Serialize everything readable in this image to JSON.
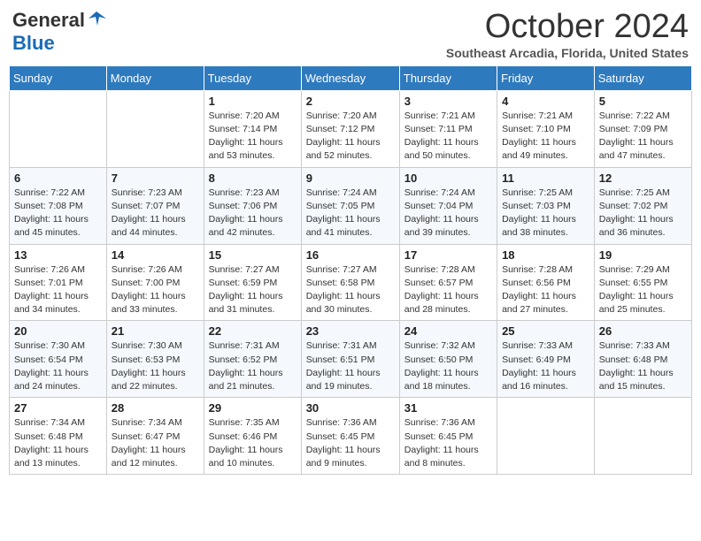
{
  "header": {
    "logo_general": "General",
    "logo_blue": "Blue",
    "month_title": "October 2024",
    "location": "Southeast Arcadia, Florida, United States"
  },
  "days_of_week": [
    "Sunday",
    "Monday",
    "Tuesday",
    "Wednesday",
    "Thursday",
    "Friday",
    "Saturday"
  ],
  "weeks": [
    [
      {
        "day": "",
        "info": ""
      },
      {
        "day": "",
        "info": ""
      },
      {
        "day": "1",
        "info": "Sunrise: 7:20 AM\nSunset: 7:14 PM\nDaylight: 11 hours and 53 minutes."
      },
      {
        "day": "2",
        "info": "Sunrise: 7:20 AM\nSunset: 7:12 PM\nDaylight: 11 hours and 52 minutes."
      },
      {
        "day": "3",
        "info": "Sunrise: 7:21 AM\nSunset: 7:11 PM\nDaylight: 11 hours and 50 minutes."
      },
      {
        "day": "4",
        "info": "Sunrise: 7:21 AM\nSunset: 7:10 PM\nDaylight: 11 hours and 49 minutes."
      },
      {
        "day": "5",
        "info": "Sunrise: 7:22 AM\nSunset: 7:09 PM\nDaylight: 11 hours and 47 minutes."
      }
    ],
    [
      {
        "day": "6",
        "info": "Sunrise: 7:22 AM\nSunset: 7:08 PM\nDaylight: 11 hours and 45 minutes."
      },
      {
        "day": "7",
        "info": "Sunrise: 7:23 AM\nSunset: 7:07 PM\nDaylight: 11 hours and 44 minutes."
      },
      {
        "day": "8",
        "info": "Sunrise: 7:23 AM\nSunset: 7:06 PM\nDaylight: 11 hours and 42 minutes."
      },
      {
        "day": "9",
        "info": "Sunrise: 7:24 AM\nSunset: 7:05 PM\nDaylight: 11 hours and 41 minutes."
      },
      {
        "day": "10",
        "info": "Sunrise: 7:24 AM\nSunset: 7:04 PM\nDaylight: 11 hours and 39 minutes."
      },
      {
        "day": "11",
        "info": "Sunrise: 7:25 AM\nSunset: 7:03 PM\nDaylight: 11 hours and 38 minutes."
      },
      {
        "day": "12",
        "info": "Sunrise: 7:25 AM\nSunset: 7:02 PM\nDaylight: 11 hours and 36 minutes."
      }
    ],
    [
      {
        "day": "13",
        "info": "Sunrise: 7:26 AM\nSunset: 7:01 PM\nDaylight: 11 hours and 34 minutes."
      },
      {
        "day": "14",
        "info": "Sunrise: 7:26 AM\nSunset: 7:00 PM\nDaylight: 11 hours and 33 minutes."
      },
      {
        "day": "15",
        "info": "Sunrise: 7:27 AM\nSunset: 6:59 PM\nDaylight: 11 hours and 31 minutes."
      },
      {
        "day": "16",
        "info": "Sunrise: 7:27 AM\nSunset: 6:58 PM\nDaylight: 11 hours and 30 minutes."
      },
      {
        "day": "17",
        "info": "Sunrise: 7:28 AM\nSunset: 6:57 PM\nDaylight: 11 hours and 28 minutes."
      },
      {
        "day": "18",
        "info": "Sunrise: 7:28 AM\nSunset: 6:56 PM\nDaylight: 11 hours and 27 minutes."
      },
      {
        "day": "19",
        "info": "Sunrise: 7:29 AM\nSunset: 6:55 PM\nDaylight: 11 hours and 25 minutes."
      }
    ],
    [
      {
        "day": "20",
        "info": "Sunrise: 7:30 AM\nSunset: 6:54 PM\nDaylight: 11 hours and 24 minutes."
      },
      {
        "day": "21",
        "info": "Sunrise: 7:30 AM\nSunset: 6:53 PM\nDaylight: 11 hours and 22 minutes."
      },
      {
        "day": "22",
        "info": "Sunrise: 7:31 AM\nSunset: 6:52 PM\nDaylight: 11 hours and 21 minutes."
      },
      {
        "day": "23",
        "info": "Sunrise: 7:31 AM\nSunset: 6:51 PM\nDaylight: 11 hours and 19 minutes."
      },
      {
        "day": "24",
        "info": "Sunrise: 7:32 AM\nSunset: 6:50 PM\nDaylight: 11 hours and 18 minutes."
      },
      {
        "day": "25",
        "info": "Sunrise: 7:33 AM\nSunset: 6:49 PM\nDaylight: 11 hours and 16 minutes."
      },
      {
        "day": "26",
        "info": "Sunrise: 7:33 AM\nSunset: 6:48 PM\nDaylight: 11 hours and 15 minutes."
      }
    ],
    [
      {
        "day": "27",
        "info": "Sunrise: 7:34 AM\nSunset: 6:48 PM\nDaylight: 11 hours and 13 minutes."
      },
      {
        "day": "28",
        "info": "Sunrise: 7:34 AM\nSunset: 6:47 PM\nDaylight: 11 hours and 12 minutes."
      },
      {
        "day": "29",
        "info": "Sunrise: 7:35 AM\nSunset: 6:46 PM\nDaylight: 11 hours and 10 minutes."
      },
      {
        "day": "30",
        "info": "Sunrise: 7:36 AM\nSunset: 6:45 PM\nDaylight: 11 hours and 9 minutes."
      },
      {
        "day": "31",
        "info": "Sunrise: 7:36 AM\nSunset: 6:45 PM\nDaylight: 11 hours and 8 minutes."
      },
      {
        "day": "",
        "info": ""
      },
      {
        "day": "",
        "info": ""
      }
    ]
  ]
}
